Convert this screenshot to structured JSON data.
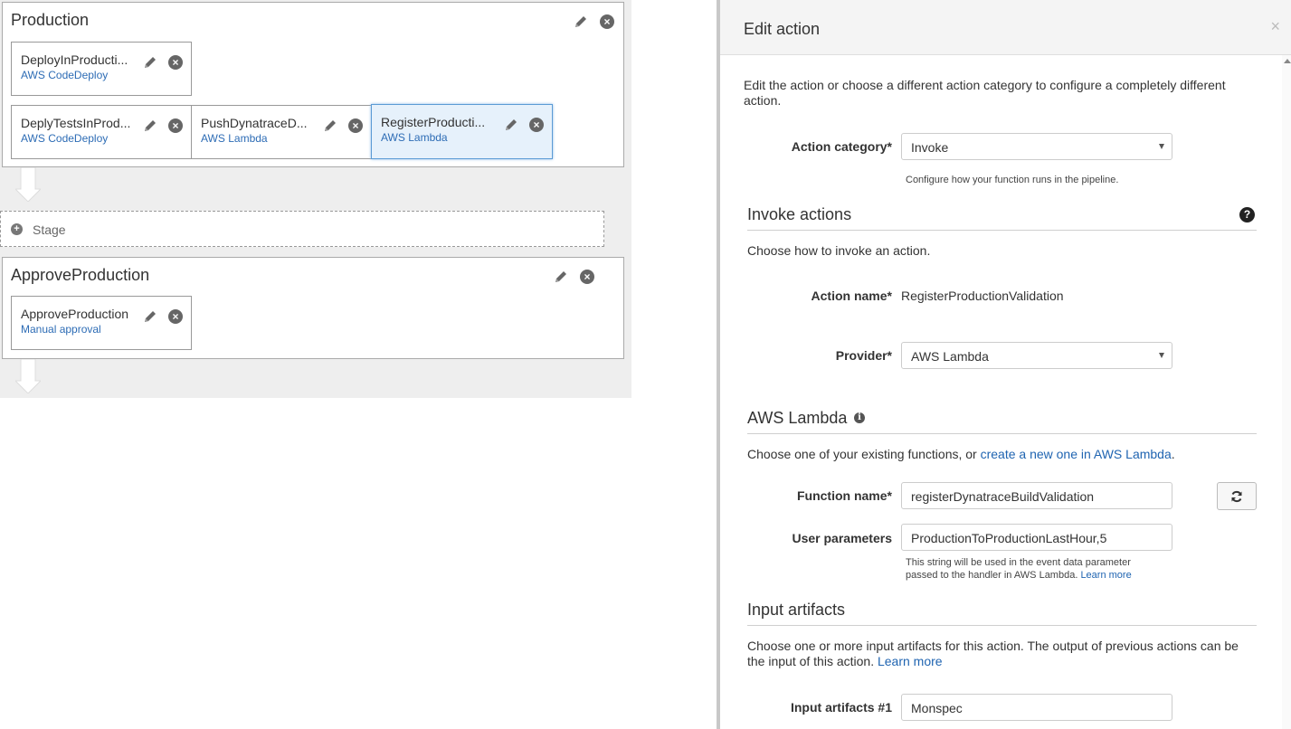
{
  "pipeline": {
    "stages": [
      {
        "title": "Production",
        "actions": [
          {
            "name": "DeployInProducti...",
            "provider": "AWS CodeDeploy"
          },
          {
            "name": "DeplyTestsInProd...",
            "provider": "AWS CodeDeploy"
          },
          {
            "name": "PushDynatraceD...",
            "provider": "AWS Lambda"
          },
          {
            "name": "RegisterProducti...",
            "provider": "AWS Lambda"
          }
        ]
      },
      {
        "title": "ApproveProduction",
        "actions": [
          {
            "name": "ApproveProduction",
            "provider": "Manual approval"
          }
        ]
      }
    ],
    "add_stage_label": "Stage"
  },
  "edit_panel": {
    "title": "Edit action",
    "close_symbol": "×",
    "intro": "Edit the action or choose a different action category to configure a completely different action.",
    "action_category": {
      "label": "Action category*",
      "value": "Invoke",
      "help": "Configure how your function runs in the pipeline."
    },
    "invoke_section": {
      "title": "Invoke actions",
      "help_icon": "?",
      "desc": "Choose how to invoke an action.",
      "action_name_label": "Action name*",
      "action_name_value": "RegisterProductionValidation",
      "provider_label": "Provider*",
      "provider_value": "AWS Lambda"
    },
    "lambda_section": {
      "title": "AWS Lambda",
      "info_icon": "i",
      "desc_prefix": "Choose one of your existing functions, or ",
      "desc_link": "create a new one in AWS Lambda",
      "desc_suffix": ".",
      "function_name_label": "Function name*",
      "function_name_value": "registerDynatraceBuildValidation",
      "user_params_label": "User parameters",
      "user_params_value": "ProductionToProductionLastHour,5",
      "user_params_help_line1": "This string will be used in the event data parameter",
      "user_params_help_line2": "passed to the handler in AWS Lambda. ",
      "user_params_help_link": "Learn more"
    },
    "input_section": {
      "title": "Input artifacts",
      "desc_line1": "Choose one or more input artifacts for this action. The output of previous actions can be",
      "desc_line2_prefix": "the input of this action. ",
      "desc_link": "Learn more",
      "artifact_label": "Input artifacts #1",
      "artifact_value": "Monspec"
    }
  },
  "icons": {
    "edit": "pencil-icon",
    "remove": "close-circle-icon",
    "refresh": "refresh-icon",
    "add": "plus-circle-icon"
  },
  "colors": {
    "link": "#1f64b1",
    "selected_bg": "#e6f1fb",
    "selected_border": "#5b9bd5"
  }
}
